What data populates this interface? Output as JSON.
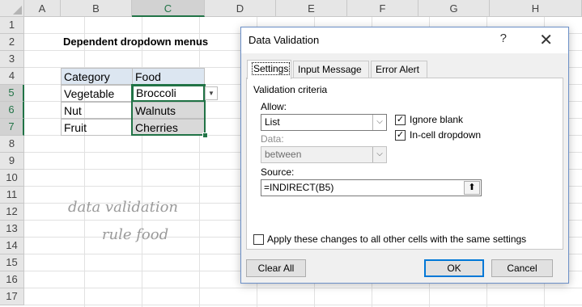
{
  "spreadsheet": {
    "columns": [
      "A",
      "B",
      "C",
      "D",
      "E",
      "F",
      "G",
      "H"
    ],
    "rows": [
      "1",
      "2",
      "3",
      "4",
      "5",
      "6",
      "7",
      "8",
      "9",
      "10",
      "11",
      "12",
      "13",
      "14",
      "15",
      "16",
      "17"
    ],
    "title": "Dependent dropdown menus",
    "table": {
      "headers": [
        "Category",
        "Food"
      ],
      "rows": [
        [
          "Vegetable",
          "Broccoli"
        ],
        [
          "Nut",
          "Walnuts"
        ],
        [
          "Fruit",
          "Cherries"
        ]
      ]
    },
    "annotation": {
      "line1": "data validation",
      "line2": "rule food"
    }
  },
  "dialog": {
    "title": "Data Validation",
    "help_glyph": "?",
    "close_glyph": "✕",
    "tabs": [
      "Settings",
      "Input Message",
      "Error Alert"
    ],
    "section_label": "Validation criteria",
    "allow_label": "Allow:",
    "allow_value": "List",
    "data_label": "Data:",
    "data_value": "between",
    "ignore_blank_label": "Ignore blank",
    "ignore_blank_checked": true,
    "incell_dropdown_label": "In-cell dropdown",
    "incell_dropdown_checked": true,
    "source_label": "Source:",
    "source_value": "=INDIRECT(B5)",
    "apply_all_label": "Apply these changes to all other cells with the same settings",
    "apply_all_checked": false,
    "clear_all_label": "Clear All",
    "ok_label": "OK",
    "cancel_label": "Cancel"
  },
  "colors": {
    "accent": "#217346",
    "dialog_border": "#6b8fc7",
    "button_focus": "#0078d7"
  }
}
